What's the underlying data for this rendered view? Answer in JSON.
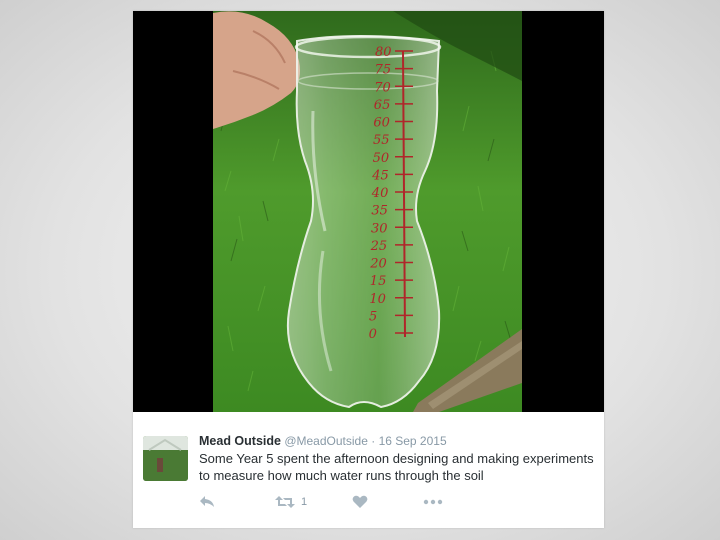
{
  "tweet": {
    "display_name": "Mead Outside",
    "handle": "@MeadOutside",
    "separator": "·",
    "date": "16 Sep 2015",
    "text": "Some Year 5 spent the afternoon designing and making experiments to measure how much water runs through the soil",
    "retweet_count": "1"
  },
  "bottle_scale": {
    "marks": [
      "80",
      "75",
      "70",
      "65",
      "60",
      "55",
      "50",
      "45",
      "40",
      "35",
      "30",
      "25",
      "20",
      "15",
      "10",
      "5",
      "0"
    ],
    "ink_color": "#b0262a"
  },
  "icons": {
    "reply": "reply-icon",
    "retweet": "retweet-icon",
    "like": "heart-icon",
    "more": "more-icon"
  },
  "colors": {
    "grass": "#3f8f22",
    "text": "#292f33",
    "muted": "#8899a6",
    "icon": "#aab8c2"
  }
}
